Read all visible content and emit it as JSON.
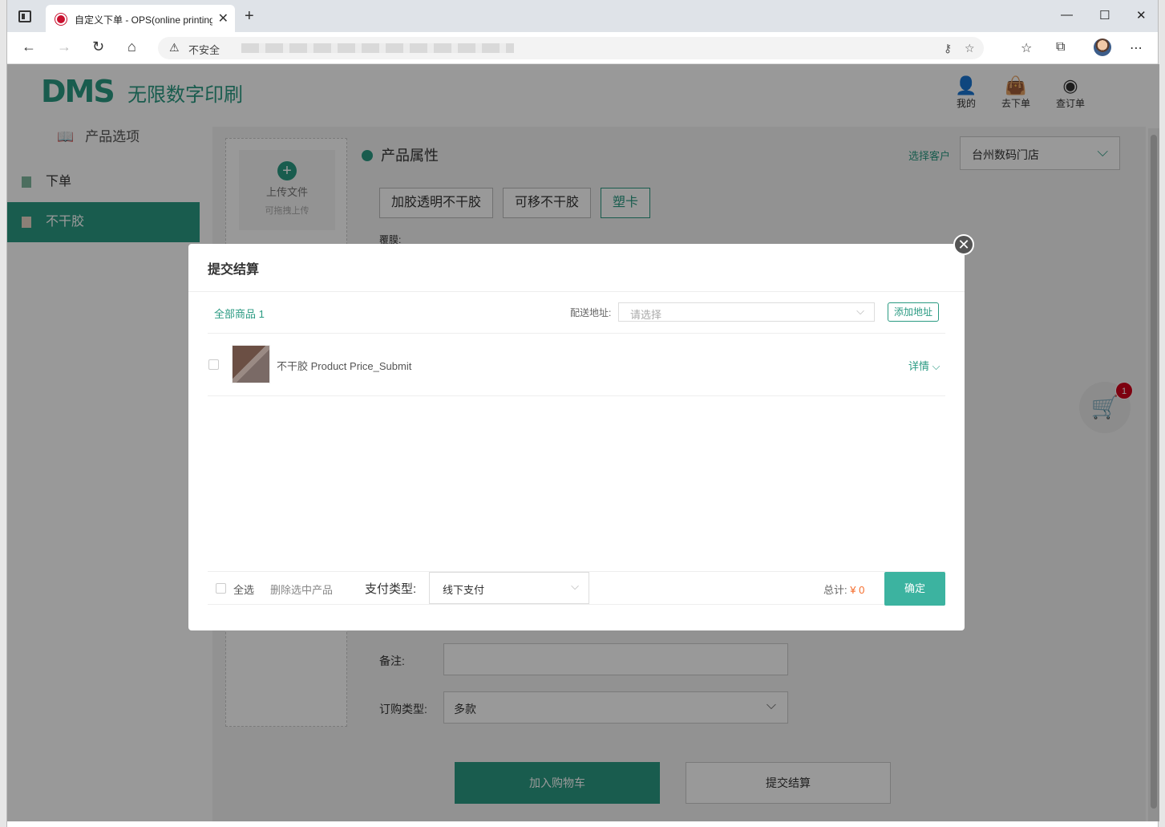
{
  "browser": {
    "tab_title": "自定义下单 - OPS(online printing",
    "url_warning": "不安全"
  },
  "header": {
    "logo": "DMS",
    "logo_sub": "无限数字印刷",
    "nav": [
      {
        "label": "我的",
        "icon": "user-icon"
      },
      {
        "label": "去下单",
        "icon": "bag-icon"
      },
      {
        "label": "查订单",
        "icon": "eye-icon"
      }
    ]
  },
  "sidebar": {
    "heading": "产品选项",
    "items": [
      {
        "label": "下单",
        "active": false
      },
      {
        "label": "不干胶",
        "active": true
      }
    ]
  },
  "main": {
    "upload_title": "上传文件",
    "upload_hint": "可拖拽上传",
    "section_title": "产品属性",
    "customer_label": "选择客户",
    "customer_value": "台州数码门店",
    "options": [
      "加胶透明不干胶",
      "可移不干胶",
      "塑卡"
    ],
    "film_label": "覆膜:",
    "remark_label": "备注:",
    "order_type_label": "订购类型:",
    "order_type_value": "多款",
    "add_to_cart": "加入购物车",
    "submit": "提交结算",
    "cart_count": "1"
  },
  "modal": {
    "title": "提交结算",
    "all_goods": "全部商品 1",
    "address_label": "配送地址:",
    "address_placeholder": "请选择",
    "add_address": "添加地址",
    "product_name": "不干胶 Product Price_Submit",
    "detail": "详情",
    "select_all": "全选",
    "delete_selected": "删除选中产品",
    "pay_type_label": "支付类型:",
    "pay_type_value": "线下支付",
    "total_label": "总计:",
    "total_value": "¥ 0",
    "confirm": "确定"
  },
  "colors": {
    "accent": "#2a9a82",
    "price": "#f56c2b",
    "badge": "#d0021b"
  }
}
